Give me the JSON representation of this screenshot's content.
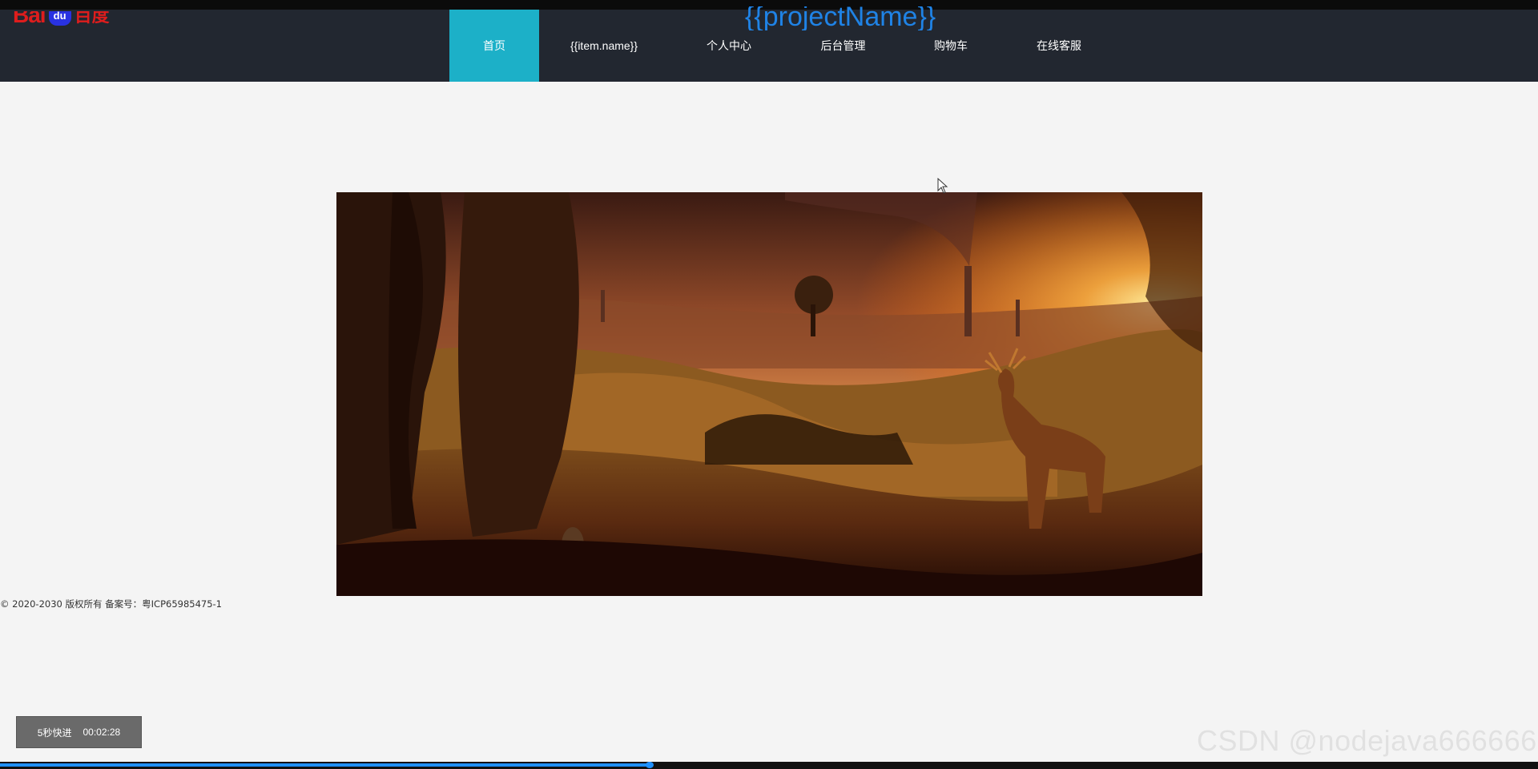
{
  "header": {
    "logo": {
      "text_bai": "Bai",
      "text_du": "du",
      "text_cn": "百度"
    },
    "project_title": "{{projectName}}",
    "nav": [
      {
        "label": "首页",
        "active": true
      },
      {
        "label": "{{item.name}}",
        "active": false
      },
      {
        "label": "个人中心",
        "active": false
      },
      {
        "label": "后台管理",
        "active": false
      },
      {
        "label": "购物车",
        "active": false
      },
      {
        "label": "在线客服",
        "active": false
      }
    ]
  },
  "banner": {
    "scene": "sunset landscape with deer, trees and chimneys"
  },
  "footer": {
    "text": "© 2020-2030 版权所有 备案号：粤ICP65985475-1"
  },
  "player": {
    "skip_label": "5秒快进",
    "time": "00:02:28",
    "progress": 0.44
  },
  "watermark": "CSDN @nodejava666666",
  "colors": {
    "nav_bg": "#222730",
    "nav_active": "#1cb0c8",
    "page_bg": "#f4f4f4",
    "title_blue": "#1f83e6",
    "progress": "#1e90ff"
  }
}
